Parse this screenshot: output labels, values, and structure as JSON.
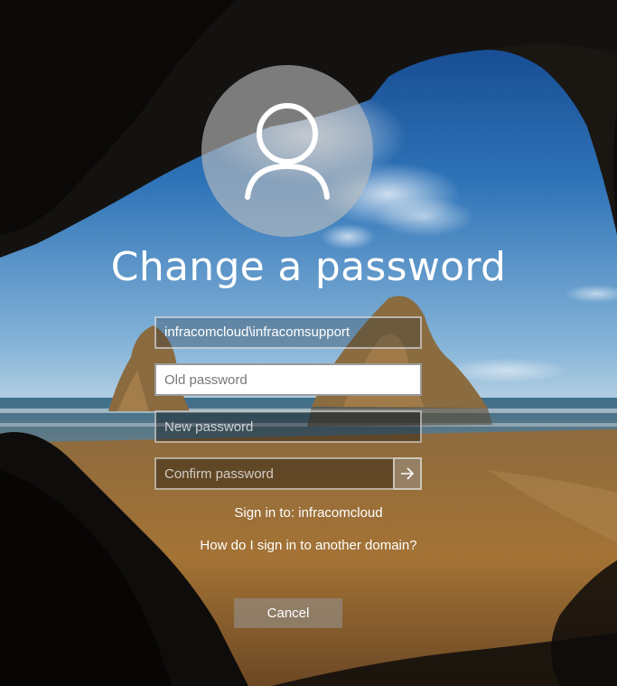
{
  "title": "Change a password",
  "username": "infracomcloud\\infracomsupport",
  "fields": {
    "old_password_placeholder": "Old password",
    "new_password_placeholder": "New password",
    "confirm_password_placeholder": "Confirm password"
  },
  "sign_in_to": "Sign in to: infracomcloud",
  "other_domain_link": "How do I sign in to another domain?",
  "cancel_label": "Cancel",
  "icons": {
    "avatar": "user-silhouette-icon",
    "submit": "arrow-right-icon"
  },
  "colors": {
    "text": "#ffffff",
    "avatar_bg": "#bebebe",
    "button_bg": "#969696",
    "focused_field_bg": "#ffffff"
  }
}
